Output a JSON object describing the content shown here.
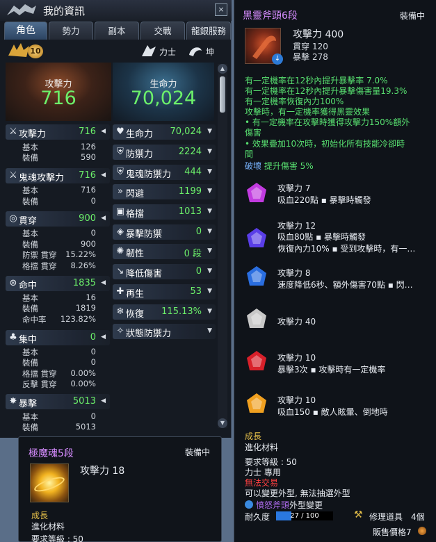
{
  "window": {
    "title": "我的資訊",
    "close_glyph": "×"
  },
  "tabs": [
    "角色",
    "勢力",
    "副本",
    "交戰",
    "龍銀服務"
  ],
  "header": {
    "level": "10",
    "class": "力士",
    "race": "坤"
  },
  "overview": {
    "attack_label": "攻擊力",
    "attack_value": "716",
    "hp_label": "生命力",
    "hp_value": "70,024"
  },
  "left_stats": [
    {
      "icon": "crossed-swords-icon",
      "glyph": "⚔",
      "name": "攻擊力",
      "value": "716",
      "subs": [
        {
          "label": "基本",
          "value": "126"
        },
        {
          "label": "裝備",
          "value": "590"
        }
      ]
    },
    {
      "icon": "soul-sword-icon",
      "glyph": "⚔",
      "name": "鬼魂攻擊力",
      "value": "716",
      "subs": [
        {
          "label": "基本",
          "value": "716"
        },
        {
          "label": "裝備",
          "value": "0"
        }
      ]
    },
    {
      "icon": "pierce-icon",
      "glyph": "◎",
      "name": "貫穿",
      "value": "900",
      "subs": [
        {
          "label": "基本",
          "value": "0"
        },
        {
          "label": "裝備",
          "value": "900"
        },
        {
          "label": "防禦 貫穿",
          "value": "15.22%"
        },
        {
          "label": "格擋 貫穿",
          "value": "8.26%"
        }
      ]
    },
    {
      "icon": "accuracy-icon",
      "glyph": "⊛",
      "name": "命中",
      "value": "1835",
      "subs": [
        {
          "label": "基本",
          "value": "16"
        },
        {
          "label": "裝備",
          "value": "1819"
        },
        {
          "label": "命中率",
          "value": "123.82%"
        }
      ]
    },
    {
      "icon": "focus-icon",
      "glyph": "♣",
      "name": "集中",
      "value": "0",
      "subs": [
        {
          "label": "基本",
          "value": "0"
        },
        {
          "label": "裝備",
          "value": "0"
        },
        {
          "label": "格擋 貫穿",
          "value": "0.00%"
        },
        {
          "label": "反擊 貫穿",
          "value": "0.00%"
        }
      ]
    },
    {
      "icon": "critical-icon",
      "glyph": "✸",
      "name": "暴擊",
      "value": "5013",
      "subs": [
        {
          "label": "基本",
          "value": "0"
        },
        {
          "label": "裝備",
          "value": "5013"
        }
      ]
    }
  ],
  "right_stats": [
    {
      "icon": "heart-icon",
      "glyph": "♥",
      "name": "生命力",
      "value": "70,024"
    },
    {
      "icon": "shield-icon",
      "glyph": "⛨",
      "name": "防禦力",
      "value": "2224"
    },
    {
      "icon": "soul-shield-icon",
      "glyph": "⛨",
      "name": "鬼魂防禦力",
      "value": "444"
    },
    {
      "icon": "evade-icon",
      "glyph": "»",
      "name": "閃避",
      "value": "1199"
    },
    {
      "icon": "block-icon",
      "glyph": "▣",
      "name": "格擋",
      "value": "1013"
    },
    {
      "icon": "crit-defense-icon",
      "glyph": "◈",
      "name": "暴擊防禦",
      "value": "0"
    },
    {
      "icon": "tenacity-icon",
      "glyph": "✺",
      "name": "韌性",
      "value": "0 段"
    },
    {
      "icon": "damage-reduction-icon",
      "glyph": "↘",
      "name": "降低傷害",
      "value": "0"
    },
    {
      "icon": "regen-icon",
      "glyph": "✚",
      "name": "再生",
      "value": "53"
    },
    {
      "icon": "recovery-icon",
      "glyph": "❄",
      "name": "恢復",
      "value": "115.13%"
    },
    {
      "icon": "status-defense-icon",
      "glyph": "✧",
      "name": "狀態防禦力",
      "value": ""
    }
  ],
  "weapon_tooltip": {
    "name": "黑靈斧頭6段",
    "equipped": "裝備中",
    "attack": "攻擊力 400",
    "pierce_label": "貫穿",
    "pierce_value": "120",
    "crit_label": "暴擊",
    "crit_value": "278",
    "effects": [
      "有一定機率在12秒內提升暴擊率 7.0%",
      "有一定機率在12秒內提升暴擊傷害量19.3%",
      "有一定機率恢復內力100%",
      "攻擊時，有一定機率獲得黑靈效果",
      "  • 有一定機率在攻擊時獲得攻擊力150%額外",
      "傷害",
      "  • 效果疊加10次時，初始化所有技能冷卻時",
      "間"
    ],
    "break_label": "破壞",
    "break_text": "提升傷害 5%",
    "gems": [
      {
        "color": "#c23be0",
        "title": "攻擊力 7",
        "desc": [
          "吸血220點 ▪ 暴擊時觸發"
        ]
      },
      {
        "color": "#5a3ee8",
        "title": "攻擊力 12",
        "desc": [
          "吸血80點 ▪ 暴擊時觸發",
          "恢復內力10% ▪ 受到攻擊時，有一…"
        ]
      },
      {
        "color": "#2a6ee0",
        "title": "攻擊力 8",
        "desc": [
          "速度降低6秒、額外傷害70點 ▪ 閃…"
        ]
      },
      {
        "color": "#c8c8c8",
        "title": "攻擊力 40",
        "desc": []
      },
      {
        "color": "#d8202a",
        "title": "攻擊力 10",
        "desc": [
          "暴擊3次 ▪ 攻擊時有一定機率"
        ]
      },
      {
        "color": "#f0a020",
        "title": "攻擊力 10",
        "desc": [
          "吸血150 ▪ 敵人眩暈、倒地時"
        ]
      }
    ],
    "growth": "成長",
    "material": "進化材料",
    "required_level": "要求等級 : 50",
    "class_only": "力士 專用",
    "no_trade": "無法交易",
    "skin_note": "可以變更外型, 無法抽選外型",
    "skin_link": "憤怒斧頭",
    "skin_suffix": "外型變更",
    "durability_label": "耐久度",
    "durability_text": "27 / 100",
    "durability_fraction": 0.27,
    "repair_label": "修理道具",
    "repair_count": "4個",
    "sell_label": "販售價格7"
  },
  "soul_tooltip": {
    "name": "極魔魂5段",
    "equipped": "裝備中",
    "attack": "攻擊力 18",
    "growth": "成長",
    "material": "進化材料",
    "required_level": "要求等級 : 50"
  }
}
